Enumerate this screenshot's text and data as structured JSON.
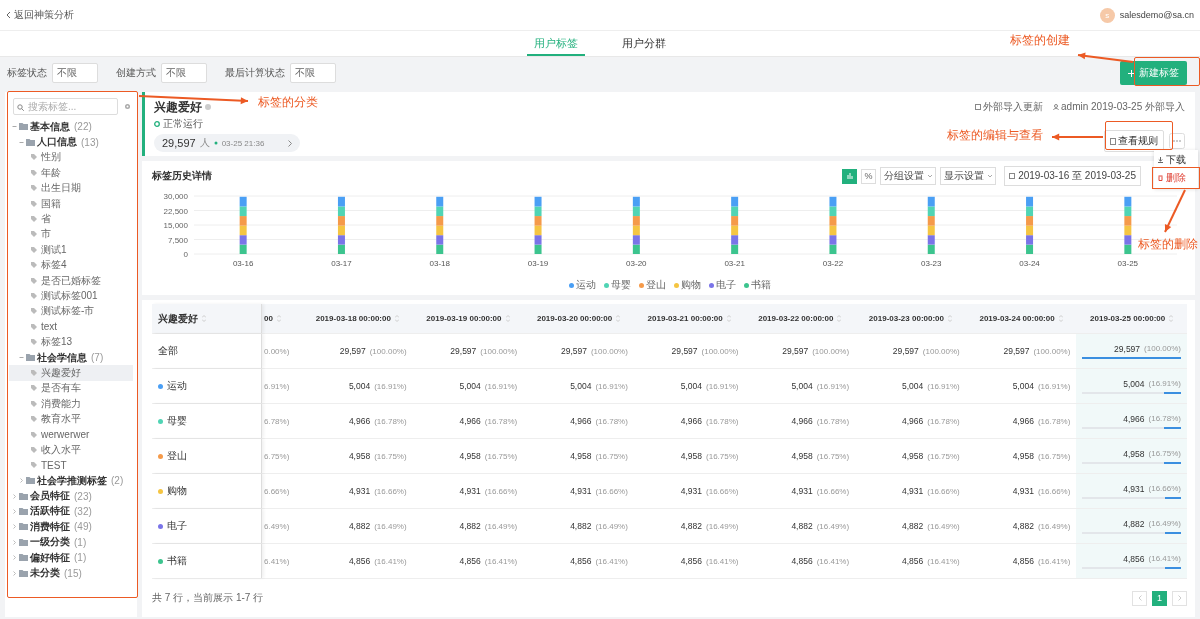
{
  "top_bar": {
    "back_link": "返回神策分析",
    "avatar": "s",
    "email": "salesdemo@sa.cn"
  },
  "tabs": [
    {
      "label": "用户标签",
      "selected": true
    },
    {
      "label": "用户分群",
      "selected": false
    }
  ],
  "filters": [
    {
      "label": "标签状态",
      "value": "不限"
    },
    {
      "label": "创建方式",
      "value": "不限"
    },
    {
      "label": "最后计算状态",
      "value": "不限"
    }
  ],
  "new_button": {
    "label": "新建标签"
  },
  "sidebar": {
    "search": {
      "placeholder": "搜索标签..."
    },
    "tree": [
      {
        "kind": "folder",
        "label": "基本信息",
        "count": "(22)",
        "expanded": true,
        "children": [
          {
            "kind": "folder",
            "label": "人口信息",
            "count": "(13)",
            "expanded": true,
            "children": [
              {
                "kind": "tag",
                "label": "性别",
                "selected": false
              },
              {
                "kind": "tag",
                "label": "年龄",
                "selected": false
              },
              {
                "kind": "tag",
                "label": "出生日期",
                "selected": false
              },
              {
                "kind": "tag",
                "label": "国籍",
                "selected": false
              },
              {
                "kind": "tag",
                "label": "省",
                "selected": false
              },
              {
                "kind": "tag",
                "label": "市",
                "selected": false
              },
              {
                "kind": "tag",
                "label": "测试1",
                "selected": false
              },
              {
                "kind": "tag",
                "label": "标签4",
                "selected": false
              },
              {
                "kind": "tag",
                "label": "是否已婚标签",
                "selected": false
              },
              {
                "kind": "tag",
                "label": "测试标签001",
                "selected": false
              },
              {
                "kind": "tag",
                "label": "测试标签-市",
                "selected": false
              },
              {
                "kind": "tag",
                "label": "text",
                "selected": false
              },
              {
                "kind": "tag",
                "label": "标签13",
                "selected": false
              }
            ]
          },
          {
            "kind": "folder",
            "label": "社会学信息",
            "count": "(7)",
            "expanded": true,
            "children": [
              {
                "kind": "tag",
                "label": "兴趣爱好",
                "selected": true
              },
              {
                "kind": "tag",
                "label": "是否有车",
                "selected": false
              },
              {
                "kind": "tag",
                "label": "消费能力",
                "selected": false
              },
              {
                "kind": "tag",
                "label": "教育水平",
                "selected": false
              },
              {
                "kind": "tag",
                "label": "werwerwer",
                "selected": false
              },
              {
                "kind": "tag",
                "label": "收入水平",
                "selected": false
              },
              {
                "kind": "tag",
                "label": "TEST",
                "selected": false
              }
            ]
          },
          {
            "kind": "folder",
            "label": "社会学推测标签",
            "count": "(2)",
            "expanded": false
          }
        ]
      },
      {
        "kind": "folder",
        "label": "会员特征",
        "count": "(23)",
        "expanded": false
      },
      {
        "kind": "folder",
        "label": "活跃特征",
        "count": "(32)",
        "expanded": false
      },
      {
        "kind": "folder",
        "label": "消费特征",
        "count": "(49)",
        "expanded": false
      },
      {
        "kind": "folder",
        "label": "一级分类",
        "count": "(1)",
        "expanded": false
      },
      {
        "kind": "folder",
        "label": "偏好特征",
        "count": "(1)",
        "expanded": false
      },
      {
        "kind": "folder",
        "label": "未分类",
        "count": "(15)",
        "expanded": false
      }
    ]
  },
  "tag_header": {
    "title": "兴趣爱好",
    "status": "正常运行",
    "count": "29,597",
    "unit": "人",
    "updated": "03-25 21:36",
    "update_mode": "外部导入更新",
    "author": "admin 2019-03-25 外部导入",
    "view_button": "查看规则"
  },
  "more_menu": {
    "items": [
      {
        "kind": "download",
        "label": "下载"
      },
      {
        "kind": "delete",
        "label": "删除"
      }
    ]
  },
  "history": {
    "title": "标签历史详情",
    "toggles": [
      {
        "kind": "bars",
        "selected": true
      },
      {
        "kind": "percent",
        "label": "%",
        "selected": false
      }
    ],
    "selects": [
      "分组设置",
      "显示设置"
    ],
    "date_range": "2019-03-16 至 2019-03-25",
    "chart_data": {
      "type": "bar",
      "stacked": true,
      "grid": true,
      "categories": [
        "03-16",
        "03-17",
        "03-18",
        "03-19",
        "03-20",
        "03-21",
        "03-22",
        "03-23",
        "03-24",
        "03-25"
      ],
      "ylim": [
        0,
        30000
      ],
      "yticks": [
        0,
        {
          "value": 7500,
          "label": "7,500"
        },
        {
          "value": 15000,
          "label": "15,000"
        },
        {
          "value": 22500,
          "label": "22,500"
        },
        {
          "value": 30000,
          "label": "30,000"
        }
      ],
      "series": [
        {
          "name": "运动",
          "color": "#4a9ff5",
          "values": [
            5004,
            5004,
            5004,
            5004,
            5004,
            5004,
            5004,
            5004,
            5004,
            5004
          ]
        },
        {
          "name": "母婴",
          "color": "#50d4b4",
          "values": [
            4966,
            4966,
            4966,
            4966,
            4966,
            4966,
            4966,
            4966,
            4966,
            4966
          ]
        },
        {
          "name": "登山",
          "color": "#f59a4a",
          "values": [
            4958,
            4958,
            4958,
            4958,
            4958,
            4958,
            4958,
            4958,
            4958,
            4958
          ]
        },
        {
          "name": "购物",
          "color": "#f5c542",
          "values": [
            4931,
            4931,
            4931,
            4931,
            4931,
            4931,
            4931,
            4931,
            4931,
            4931
          ]
        },
        {
          "name": "电子",
          "color": "#7a74e8",
          "values": [
            4882,
            4882,
            4882,
            4882,
            4882,
            4882,
            4882,
            4882,
            4882,
            4882
          ]
        },
        {
          "name": "书籍",
          "color": "#3cc48e",
          "values": [
            4856,
            4856,
            4856,
            4856,
            4856,
            4856,
            4856,
            4856,
            4856,
            4856
          ]
        }
      ]
    }
  },
  "table": {
    "columns": [
      "兴趣爱好",
      "00",
      "2019-03-18 00:00:00",
      "2019-03-19 00:00:00",
      "2019-03-20 00:00:00",
      "2019-03-21 00:00:00",
      "2019-03-22 00:00:00",
      "2019-03-23 00:00:00",
      "2019-03-24 00:00:00",
      "2019-03-25 00:00:00"
    ],
    "rows": [
      {
        "cells": [
          {
            "label": "全部"
          },
          {
            "pct": "0.00%)"
          },
          {
            "value": "29,597",
            "pct": "(100.00%)"
          },
          {
            "value": "29,597",
            "pct": "(100.00%)"
          },
          {
            "value": "29,597",
            "pct": "(100.00%)"
          },
          {
            "value": "29,597",
            "pct": "(100.00%)"
          },
          {
            "value": "29,597",
            "pct": "(100.00%)"
          },
          {
            "value": "29,597",
            "pct": "(100.00%)"
          },
          {
            "value": "29,597",
            "pct": "(100.00%)"
          },
          {
            "value": "29,597",
            "pct": "(100.00%)",
            "level": 1
          }
        ]
      },
      {
        "cells": [
          {
            "label": "运动",
            "color": "#4a9ff5"
          },
          {
            "pct": "6.91%)"
          },
          {
            "value": "5,004",
            "pct": "(16.91%)"
          },
          {
            "value": "5,004",
            "pct": "(16.91%)"
          },
          {
            "value": "5,004",
            "pct": "(16.91%)"
          },
          {
            "value": "5,004",
            "pct": "(16.91%)"
          },
          {
            "value": "5,004",
            "pct": "(16.91%)"
          },
          {
            "value": "5,004",
            "pct": "(16.91%)"
          },
          {
            "value": "5,004",
            "pct": "(16.91%)"
          },
          {
            "value": "5,004",
            "pct": "(16.91%)",
            "level": 0.1691
          }
        ]
      },
      {
        "cells": [
          {
            "label": "母婴",
            "color": "#50d4b4"
          },
          {
            "pct": "6.78%)"
          },
          {
            "value": "4,966",
            "pct": "(16.78%)"
          },
          {
            "value": "4,966",
            "pct": "(16.78%)"
          },
          {
            "value": "4,966",
            "pct": "(16.78%)"
          },
          {
            "value": "4,966",
            "pct": "(16.78%)"
          },
          {
            "value": "4,966",
            "pct": "(16.78%)"
          },
          {
            "value": "4,966",
            "pct": "(16.78%)"
          },
          {
            "value": "4,966",
            "pct": "(16.78%)"
          },
          {
            "value": "4,966",
            "pct": "(16.78%)",
            "level": 0.1678
          }
        ]
      },
      {
        "cells": [
          {
            "label": "登山",
            "color": "#f59a4a"
          },
          {
            "pct": "6.75%)"
          },
          {
            "value": "4,958",
            "pct": "(16.75%)"
          },
          {
            "value": "4,958",
            "pct": "(16.75%)"
          },
          {
            "value": "4,958",
            "pct": "(16.75%)"
          },
          {
            "value": "4,958",
            "pct": "(16.75%)"
          },
          {
            "value": "4,958",
            "pct": "(16.75%)"
          },
          {
            "value": "4,958",
            "pct": "(16.75%)"
          },
          {
            "value": "4,958",
            "pct": "(16.75%)"
          },
          {
            "value": "4,958",
            "pct": "(16.75%)",
            "level": 0.1675
          }
        ]
      },
      {
        "cells": [
          {
            "label": "购物",
            "color": "#f5c542"
          },
          {
            "pct": "6.66%)"
          },
          {
            "value": "4,931",
            "pct": "(16.66%)"
          },
          {
            "value": "4,931",
            "pct": "(16.66%)"
          },
          {
            "value": "4,931",
            "pct": "(16.66%)"
          },
          {
            "value": "4,931",
            "pct": "(16.66%)"
          },
          {
            "value": "4,931",
            "pct": "(16.66%)"
          },
          {
            "value": "4,931",
            "pct": "(16.66%)"
          },
          {
            "value": "4,931",
            "pct": "(16.66%)"
          },
          {
            "value": "4,931",
            "pct": "(16.66%)",
            "level": 0.1666
          }
        ]
      },
      {
        "cells": [
          {
            "label": "电子",
            "color": "#7a74e8"
          },
          {
            "pct": "6.49%)"
          },
          {
            "value": "4,882",
            "pct": "(16.49%)"
          },
          {
            "value": "4,882",
            "pct": "(16.49%)"
          },
          {
            "value": "4,882",
            "pct": "(16.49%)"
          },
          {
            "value": "4,882",
            "pct": "(16.49%)"
          },
          {
            "value": "4,882",
            "pct": "(16.49%)"
          },
          {
            "value": "4,882",
            "pct": "(16.49%)"
          },
          {
            "value": "4,882",
            "pct": "(16.49%)"
          },
          {
            "value": "4,882",
            "pct": "(16.49%)",
            "level": 0.1649
          }
        ]
      },
      {
        "cells": [
          {
            "label": "书籍",
            "color": "#3cc48e"
          },
          {
            "pct": "6.41%)"
          },
          {
            "value": "4,856",
            "pct": "(16.41%)"
          },
          {
            "value": "4,856",
            "pct": "(16.41%)"
          },
          {
            "value": "4,856",
            "pct": "(16.41%)"
          },
          {
            "value": "4,856",
            "pct": "(16.41%)"
          },
          {
            "value": "4,856",
            "pct": "(16.41%)"
          },
          {
            "value": "4,856",
            "pct": "(16.41%)"
          },
          {
            "value": "4,856",
            "pct": "(16.41%)"
          },
          {
            "value": "4,856",
            "pct": "(16.41%)",
            "level": 0.1641
          }
        ]
      }
    ],
    "summary": "共 7 行，当前展示 1-7 行",
    "pages": [
      {
        "label": "1",
        "selected": true
      }
    ]
  },
  "annotations": [
    {
      "text": "标签的创建"
    },
    {
      "text": "标签的分类"
    },
    {
      "text": "标签的编辑与查看"
    },
    {
      "text": "标签的删除"
    }
  ]
}
